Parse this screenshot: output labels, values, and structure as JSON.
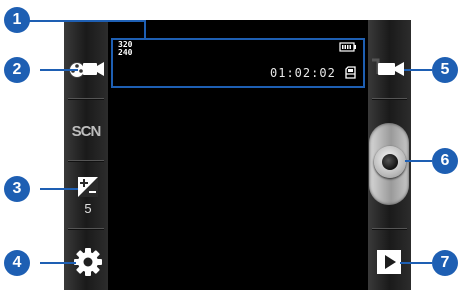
{
  "callouts": [
    "1",
    "2",
    "3",
    "4",
    "5",
    "6",
    "7"
  ],
  "viewfinder": {
    "resolution_width": "320",
    "resolution_height": "240",
    "timer": "01:02:02"
  },
  "left_panel": {
    "scene_label": "SCN",
    "exposure_value": "5"
  },
  "icons": {
    "record_mode": "video-record-mode-icon",
    "exposure": "exposure-icon",
    "settings": "gear-icon",
    "switch_mode": "camcorder-icon",
    "shutter": "shutter-button",
    "gallery": "play-icon",
    "battery": "battery-icon",
    "storage": "memory-card-icon"
  },
  "colors": {
    "accent": "#1e5fb3",
    "viewfinder_bg": "#000000",
    "panel_bg": "#1a1a1a"
  }
}
